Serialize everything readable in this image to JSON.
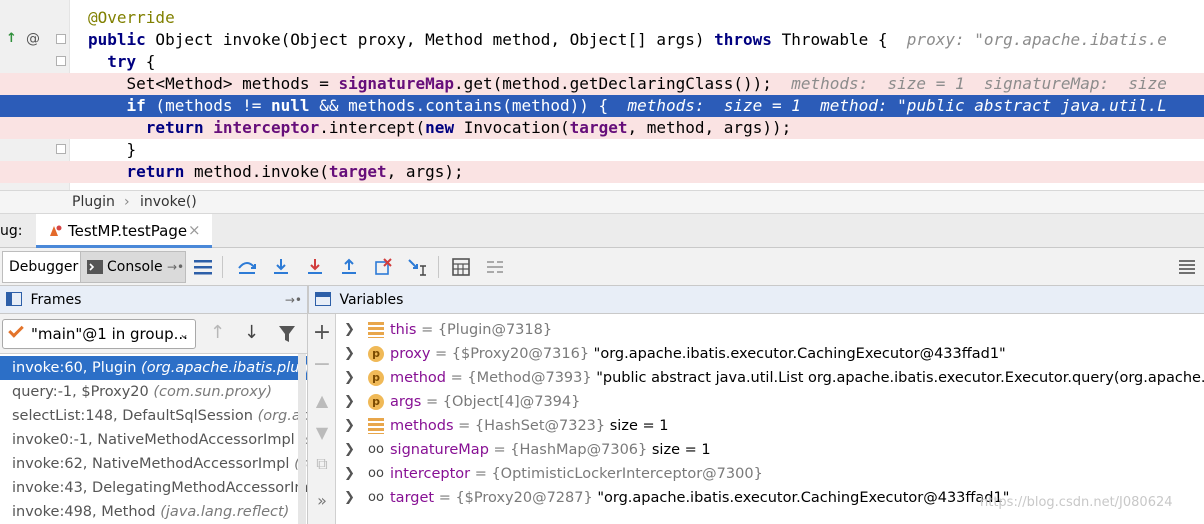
{
  "editor": {
    "lines": [
      {
        "tokens": [
          {
            "t": "@Override",
            "c": "ann"
          }
        ]
      },
      {
        "tokens": [
          {
            "t": "public",
            "c": "kw"
          },
          {
            "t": " Object invoke(Object proxy, Method method, Object[] args) ",
            "c": ""
          },
          {
            "t": "throws",
            "c": "kw"
          },
          {
            "t": " Throwable {  ",
            "c": ""
          },
          {
            "t": "proxy: \"org.apache.ibatis.e",
            "c": "hint"
          }
        ]
      },
      {
        "tokens": [
          {
            "t": "  ",
            "c": ""
          },
          {
            "t": "try",
            "c": "kw"
          },
          {
            "t": " {",
            "c": ""
          }
        ]
      },
      {
        "tokens": [
          {
            "t": "    Set<Method> methods = ",
            "c": ""
          },
          {
            "t": "signatureMap",
            "c": "fld"
          },
          {
            "t": ".get(method.getDeclaringClass());  ",
            "c": ""
          },
          {
            "t": "methods:  size = 1  signatureMap:  size",
            "c": "hint"
          }
        ]
      },
      {
        "tokens": [
          {
            "t": "    ",
            "c": ""
          },
          {
            "t": "if",
            "c": "kw"
          },
          {
            "t": " (methods != ",
            "c": ""
          },
          {
            "t": "null",
            "c": "kw"
          },
          {
            "t": " && methods.contains(method)) {  ",
            "c": ""
          },
          {
            "t": "methods:  size = 1  method: \"public abstract java.util.L",
            "c": "hint"
          }
        ]
      },
      {
        "tokens": [
          {
            "t": "      ",
            "c": ""
          },
          {
            "t": "return",
            "c": "kw"
          },
          {
            "t": " ",
            "c": ""
          },
          {
            "t": "interceptor",
            "c": "fld"
          },
          {
            "t": ".intercept(",
            "c": ""
          },
          {
            "t": "new",
            "c": "kw"
          },
          {
            "t": " Invocation(",
            "c": ""
          },
          {
            "t": "target",
            "c": "fld"
          },
          {
            "t": ", method, args));",
            "c": ""
          }
        ]
      },
      {
        "tokens": [
          {
            "t": "    }",
            "c": ""
          }
        ]
      },
      {
        "tokens": [
          {
            "t": "    ",
            "c": ""
          },
          {
            "t": "return",
            "c": "kw"
          },
          {
            "t": " method.invoke(",
            "c": ""
          },
          {
            "t": "target",
            "c": "fld"
          },
          {
            "t": ", args);",
            "c": ""
          }
        ]
      }
    ]
  },
  "breadcrumb": {
    "items": [
      "Plugin",
      "invoke()"
    ],
    "sep": "›"
  },
  "debug": {
    "label": "ug:",
    "tab": "TestMP.testPage",
    "close": "×"
  },
  "toolbar": {
    "debugger": "Debugger",
    "console": "Console"
  },
  "frames": {
    "title": "Frames",
    "thread": "\"main\"@1 in group...",
    "items": [
      {
        "m": "invoke:60, Plugin ",
        "p": "(org.apache.ibatis.plugin)"
      },
      {
        "m": "query:-1, $Proxy20 ",
        "p": "(com.sun.proxy)"
      },
      {
        "m": "selectList:148, DefaultSqlSession ",
        "p": "(org.apache"
      },
      {
        "m": "invoke0:-1, NativeMethodAccessorImpl ",
        "p": "(sun"
      },
      {
        "m": "invoke:62, NativeMethodAccessorImpl ",
        "p": "(sun."
      },
      {
        "m": "invoke:43, DelegatingMethodAccessorImpl ",
        "p": "("
      },
      {
        "m": "invoke:498, Method ",
        "p": "(java.lang.reflect)"
      }
    ]
  },
  "variables": {
    "title": "Variables",
    "rows": [
      {
        "icon": "field",
        "name": "this",
        "type": " = {Plugin@7318}",
        "val": ""
      },
      {
        "icon": "param",
        "name": "proxy",
        "type": " = {$Proxy20@7316} ",
        "val": "\"org.apache.ibatis.executor.CachingExecutor@433ffad1\""
      },
      {
        "icon": "param",
        "name": "method",
        "type": " = {Method@7393} ",
        "val": "\"public abstract java.util.List org.apache.ibatis.executor.Executor.query(org.apache.ibatis.mapp"
      },
      {
        "icon": "param",
        "name": "args",
        "type": " = {Object[4]@7394}",
        "val": ""
      },
      {
        "icon": "field",
        "name": "methods",
        "type": " = {HashSet@7323} ",
        "val": " size = 1"
      },
      {
        "icon": "watch",
        "name": "signatureMap",
        "type": " = {HashMap@7306} ",
        "val": " size = 1"
      },
      {
        "icon": "watch",
        "name": "interceptor",
        "type": " = {OptimisticLockerInterceptor@7300}",
        "val": ""
      },
      {
        "icon": "watch",
        "name": "target",
        "type": " = {$Proxy20@7287} ",
        "val": "\"org.apache.ibatis.executor.CachingExecutor@433ffad1\""
      }
    ]
  },
  "watermark": "https://blog.csdn.net/J080624"
}
